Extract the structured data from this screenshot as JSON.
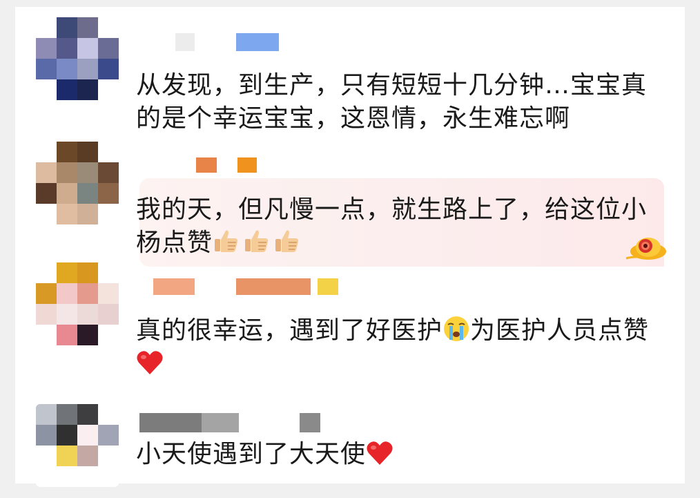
{
  "comments": [
    {
      "text": "从发现，到生产，只有短短十几分钟…宝宝真的是个幸运宝宝，这恩情，永生难忘啊"
    },
    {
      "text": "我的天，但凡慢一点，就生路上了，给这位小杨点赞",
      "emojis": [
        "thumbs-up-icon",
        "thumbs-up-icon",
        "thumbs-up-icon"
      ]
    },
    {
      "text_before": "真的很幸运，遇到了好医护",
      "text_after": "为医护人员点赞",
      "emojis": [
        "crying-face-icon",
        "heart-icon"
      ]
    },
    {
      "text": "小天使遇到了大天使",
      "emojis": [
        "heart-icon"
      ]
    }
  ],
  "colors": {
    "background": "#f0f0f0",
    "card": "#ffffff",
    "text": "#1a1a1a",
    "heart": "#e8242b"
  }
}
